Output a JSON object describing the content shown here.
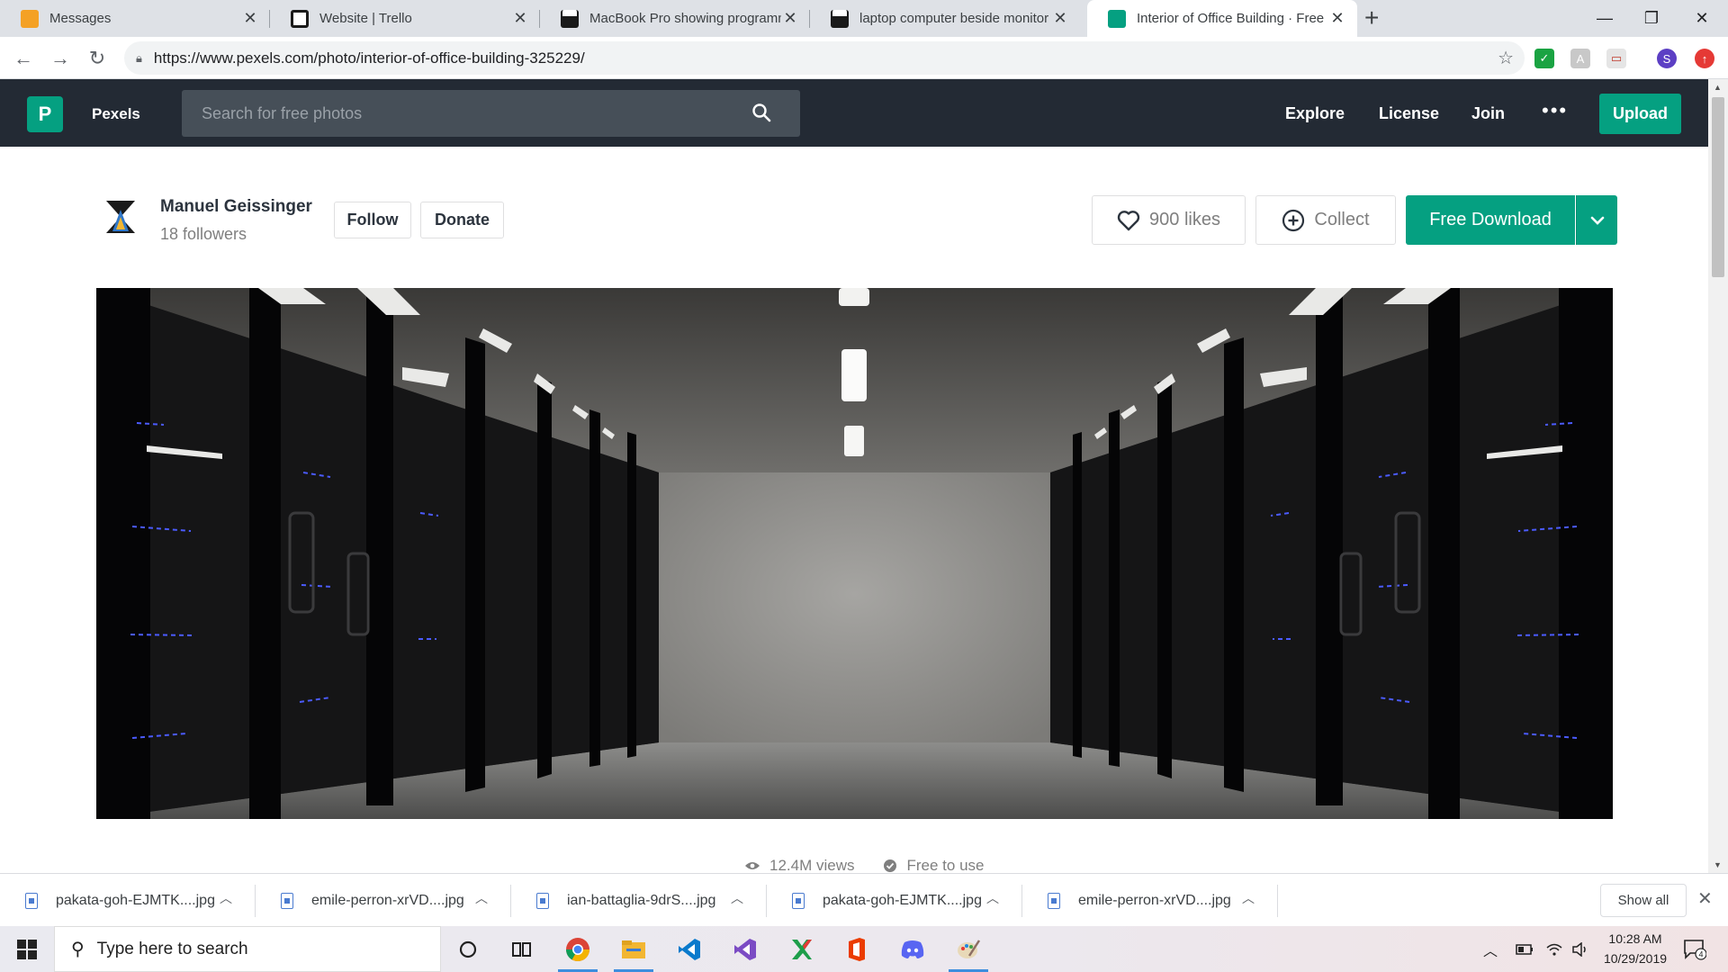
{
  "browser": {
    "tabs": [
      {
        "title": "Messages",
        "favicon_color": "#f4a125"
      },
      {
        "title": "Website | Trello",
        "favicon_color": "#1a1a1a"
      },
      {
        "title": "MacBook Pro showing programm",
        "favicon_color": "#1a1a1a"
      },
      {
        "title": "laptop computer beside monitor",
        "favicon_color": "#1a1a1a"
      },
      {
        "title": "Interior of Office Building · Free S",
        "favicon_color": "#05a081",
        "active": true
      }
    ],
    "url": "https://www.pexels.com/photo/interior-of-office-building-325229/",
    "profile_initial": "S"
  },
  "site": {
    "logo_letter": "P",
    "brand": "Pexels",
    "search_placeholder": "Search for free photos",
    "nav": [
      "Explore",
      "License",
      "Join"
    ],
    "more": "•••",
    "upload": "Upload",
    "accent": "#05a081",
    "header_bg": "#232a34"
  },
  "photo": {
    "photographer": "Manuel Geissinger",
    "followers": "18 followers",
    "follow_label": "Follow",
    "donate_label": "Donate",
    "likes_label": "900 likes",
    "collect_label": "Collect",
    "download_label": "Free Download",
    "views": "12.4M views",
    "license_note": "Free to use"
  },
  "downloads": {
    "items": [
      "pakata-goh-EJMTK....jpg",
      "emile-perron-xrVD....jpg",
      "ian-battaglia-9drS....jpg",
      "pakata-goh-EJMTK....jpg",
      "emile-perron-xrVD....jpg"
    ],
    "show_all": "Show all"
  },
  "taskbar": {
    "search_placeholder": "Type here to search",
    "time": "10:28 AM",
    "date": "10/29/2019",
    "notification_count": "4"
  }
}
